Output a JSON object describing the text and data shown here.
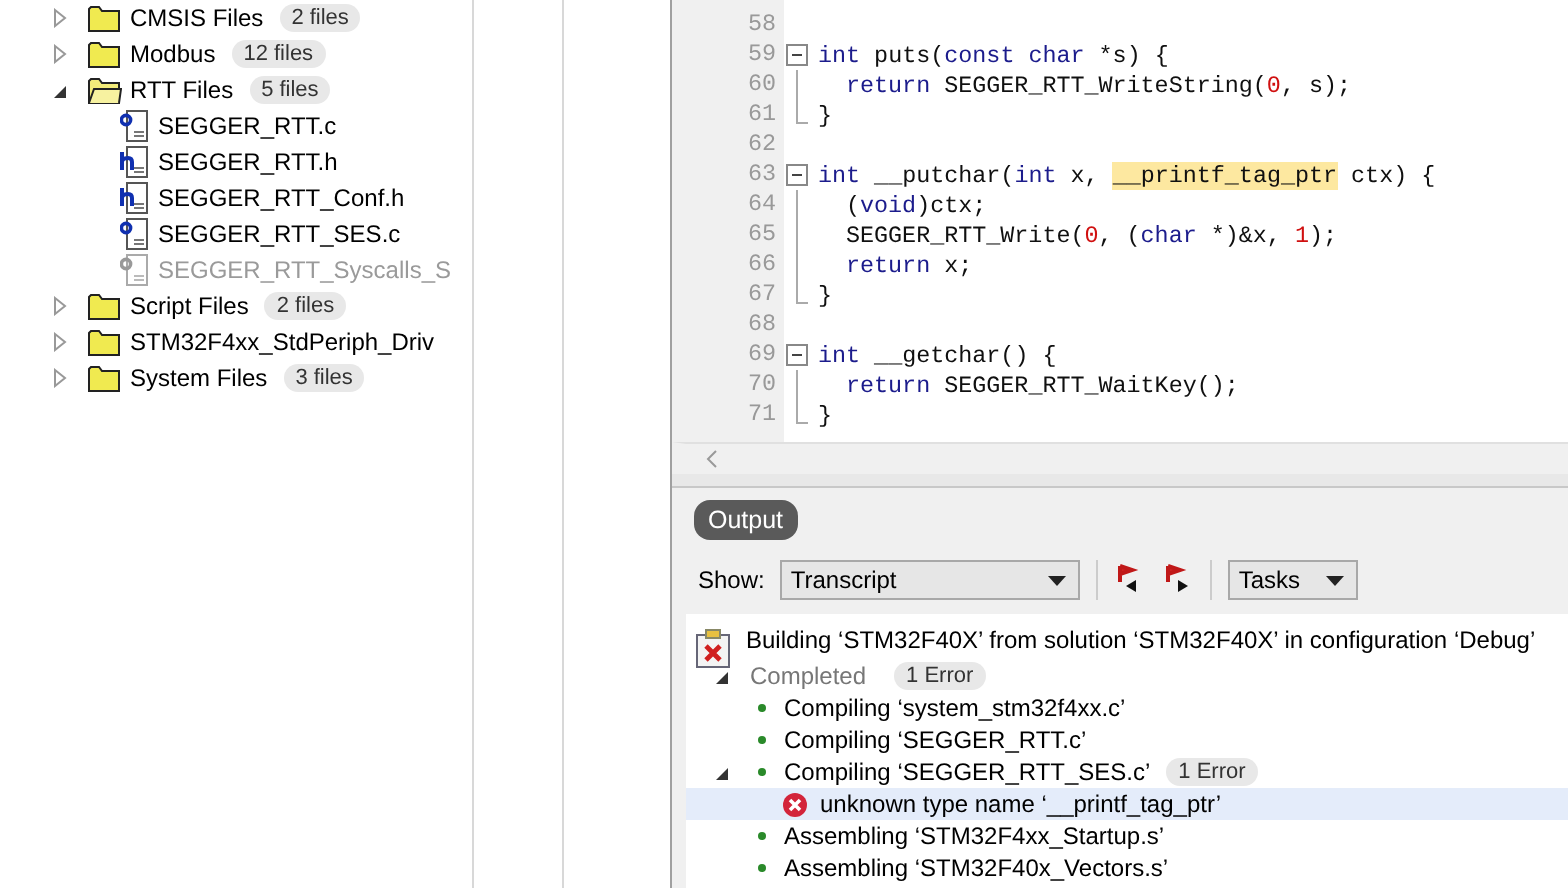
{
  "project_tree": [
    {
      "kind": "folder",
      "label": "CMSIS Files",
      "badge": "2 files",
      "expanded": false
    },
    {
      "kind": "folder",
      "label": "Modbus",
      "badge": "12 files",
      "expanded": false
    },
    {
      "kind": "folder",
      "label": "RTT Files",
      "badge": "5 files",
      "expanded": true,
      "children": [
        {
          "kind": "c",
          "label": "SEGGER_RTT.c",
          "excluded": false
        },
        {
          "kind": "h",
          "label": "SEGGER_RTT.h",
          "excluded": false
        },
        {
          "kind": "h",
          "label": "SEGGER_RTT_Conf.h",
          "excluded": false
        },
        {
          "kind": "c",
          "label": "SEGGER_RTT_SES.c",
          "excluded": false
        },
        {
          "kind": "c",
          "label": "SEGGER_RTT_Syscalls_S",
          "excluded": true
        }
      ]
    },
    {
      "kind": "folder",
      "label": "Script Files",
      "badge": "2 files",
      "expanded": false
    },
    {
      "kind": "folder",
      "label": "STM32F4xx_StdPeriph_Driv",
      "expanded": false
    },
    {
      "kind": "folder",
      "label": "System Files",
      "badge": "3 files",
      "expanded": false
    }
  ],
  "editor": {
    "lines": [
      {
        "number": "58",
        "kind": "blank"
      },
      {
        "number": "59",
        "kind": "fold_start",
        "tokens": [
          {
            "kind": "keyword",
            "text": "int"
          },
          {
            "kind": "plain",
            "text": " puts("
          },
          {
            "kind": "keyword",
            "text": "const char"
          },
          {
            "kind": "plain",
            "text": " *s) {"
          }
        ]
      },
      {
        "number": "60",
        "kind": "body",
        "tokens": [
          {
            "kind": "keyword",
            "text": "return"
          },
          {
            "kind": "plain",
            "text": " SEGGER_RTT_WriteString("
          },
          {
            "kind": "number",
            "text": "0"
          },
          {
            "kind": "plain",
            "text": ", s);"
          }
        ]
      },
      {
        "number": "61",
        "kind": "fold_end",
        "tokens": [
          {
            "kind": "plain",
            "text": "}"
          }
        ]
      },
      {
        "number": "62",
        "kind": "blank"
      },
      {
        "number": "63",
        "kind": "fold_start",
        "tokens": [
          {
            "kind": "keyword",
            "text": "int"
          },
          {
            "kind": "plain",
            "text": " __putchar("
          },
          {
            "kind": "keyword",
            "text": "int"
          },
          {
            "kind": "plain",
            "text": " x, "
          },
          {
            "kind": "highlight",
            "text": "__printf_tag_ptr"
          },
          {
            "kind": "plain",
            "text": " ctx) {"
          }
        ]
      },
      {
        "number": "64",
        "kind": "body",
        "tokens": [
          {
            "kind": "plain",
            "text": "("
          },
          {
            "kind": "keyword",
            "text": "void"
          },
          {
            "kind": "plain",
            "text": ")ctx;"
          }
        ]
      },
      {
        "number": "65",
        "kind": "body",
        "tokens": [
          {
            "kind": "plain",
            "text": "SEGGER_RTT_Write("
          },
          {
            "kind": "number",
            "text": "0"
          },
          {
            "kind": "plain",
            "text": ", ("
          },
          {
            "kind": "keyword",
            "text": "char"
          },
          {
            "kind": "plain",
            "text": " *)&x, "
          },
          {
            "kind": "number",
            "text": "1"
          },
          {
            "kind": "plain",
            "text": ");"
          }
        ]
      },
      {
        "number": "66",
        "kind": "body",
        "tokens": [
          {
            "kind": "keyword",
            "text": "return"
          },
          {
            "kind": "plain",
            "text": " x;"
          }
        ]
      },
      {
        "number": "67",
        "kind": "fold_end",
        "tokens": [
          {
            "kind": "plain",
            "text": "}"
          }
        ]
      },
      {
        "number": "68",
        "kind": "blank"
      },
      {
        "number": "69",
        "kind": "fold_start",
        "tokens": [
          {
            "kind": "keyword",
            "text": "int"
          },
          {
            "kind": "plain",
            "text": " __getchar() {"
          }
        ]
      },
      {
        "number": "70",
        "kind": "body",
        "tokens": [
          {
            "kind": "keyword",
            "text": "return"
          },
          {
            "kind": "plain",
            "text": " SEGGER_RTT_WaitKey();"
          }
        ]
      },
      {
        "number": "71",
        "kind": "fold_end",
        "tokens": [
          {
            "kind": "plain",
            "text": "}"
          }
        ]
      }
    ]
  },
  "output": {
    "tab": "Output",
    "show_label": "Show:",
    "show_value": "Transcript",
    "filter_value": "Tasks",
    "build": {
      "text": "Building ‘STM32F40X’ from solution ‘STM32F40X’ in configuration ‘Debug’",
      "status": "Completed",
      "badge": "1 Error",
      "expanded": true,
      "children": [
        {
          "kind": "step",
          "text": "Compiling ‘system_stm32f4xx.c’"
        },
        {
          "kind": "step",
          "text": "Compiling ‘SEGGER_RTT.c’"
        },
        {
          "kind": "step",
          "text": "Compiling ‘SEGGER_RTT_SES.c’",
          "badge": "1 Error",
          "expanded": true,
          "children": [
            {
              "kind": "error",
              "text": "unknown type name ‘__printf_tag_ptr’",
              "selected": true
            }
          ]
        },
        {
          "kind": "step",
          "text": "Assembling ‘STM32F4xx_Startup.s’"
        },
        {
          "kind": "step",
          "text": "Assembling ‘STM32F40x_Vectors.s’"
        }
      ]
    }
  }
}
